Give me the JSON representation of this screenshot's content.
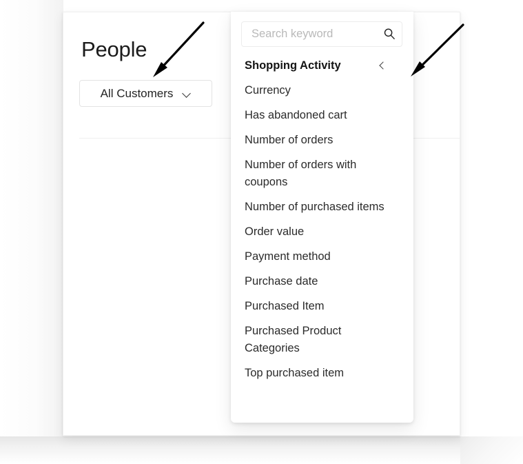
{
  "page": {
    "title": "People"
  },
  "filter": {
    "label": "All Customers",
    "chevron_icon": "chevron-down-icon"
  },
  "dropdown": {
    "search": {
      "placeholder": "Search keyword",
      "value": "",
      "icon": "search-icon"
    },
    "group": {
      "label": "Shopping Activity",
      "chevron_icon": "chevron-left-icon"
    },
    "items": [
      {
        "label": "Currency"
      },
      {
        "label": "Has abandoned cart"
      },
      {
        "label": "Number of orders"
      },
      {
        "label": "Number of orders with coupons"
      },
      {
        "label": "Number of purchased items"
      },
      {
        "label": "Order value"
      },
      {
        "label": "Payment method"
      },
      {
        "label": "Purchase date"
      },
      {
        "label": "Purchased Item"
      },
      {
        "label": "Purchased Product Categories"
      },
      {
        "label": "Top purchased item"
      }
    ]
  },
  "annotations": [
    {
      "name": "arrow-to-filter-button",
      "color": "#000000"
    },
    {
      "name": "arrow-to-dropdown-group",
      "color": "#000000"
    }
  ],
  "colors": {
    "card_background": "#ffffff",
    "page_background": "#ffffff",
    "text_primary": "#2b2b2b",
    "text_heading": "#1b1b1b",
    "placeholder": "#b9b9b9",
    "border": "#e3e3e3",
    "divider": "#efefef"
  }
}
